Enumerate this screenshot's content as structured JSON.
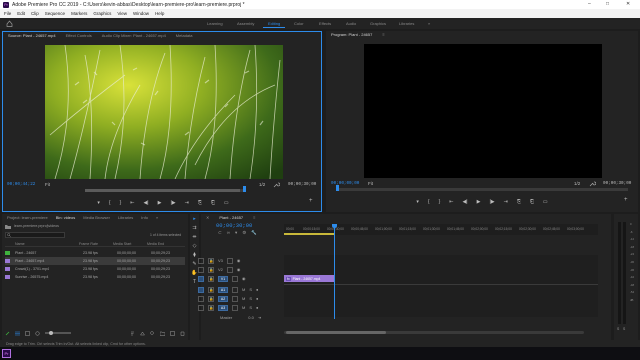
{
  "app": {
    "logo_text": "Pr",
    "title": "Adobe Premiere Pro CC 2019 - C:\\Users\\kevin-abbas\\Desktop\\learn-premiere-pro\\learn-premiere.prproj *",
    "window_controls": [
      "–",
      "□",
      "✕"
    ]
  },
  "menu": [
    "File",
    "Edit",
    "Clip",
    "Sequence",
    "Markers",
    "Graphics",
    "View",
    "Window",
    "Help"
  ],
  "workspaces": {
    "home_icon": "home-icon",
    "items": [
      "Learning",
      "Assembly",
      "Editing",
      "Color",
      "Effects",
      "Audio",
      "Graphics",
      "Libraries"
    ],
    "active": "Editing",
    "more": "»"
  },
  "source": {
    "tabs": [
      "Source: Plant - 24657.mp4",
      "Effect Controls",
      "Audio Clip Mixer: Plant - 24657.mp4",
      "Metadata"
    ],
    "timecode_in": "00;00;44;22",
    "fit": "Fit",
    "resolution": "1/2",
    "timecode_out": "00;00;30;00",
    "buttons": [
      "▾",
      "{",
      "}",
      "⇤",
      "◀|",
      "▶",
      "|▶",
      "⇥",
      "⎘",
      "⎗",
      "▭",
      "+"
    ]
  },
  "program": {
    "tabs": [
      "Program: Plant - 24657",
      "≡"
    ],
    "timecode_in": "00;00;00;00",
    "fit": "Fit",
    "resolution": "1/2",
    "timecode_out": "00;00;30;00",
    "buttons": [
      "▾",
      "{",
      "}",
      "⇤",
      "◀|",
      "▶",
      "|▶",
      "⇥",
      "⎘",
      "⎗",
      "▭",
      "+"
    ]
  },
  "project": {
    "tabs": [
      "Project: learn-premiere",
      "Bin: videos",
      "Media Browser",
      "Libraries",
      "Info",
      "»"
    ],
    "path": "learn-premiere.prproj\\videos",
    "selected_count": "1 of 4 items selected",
    "columns": [
      "Name",
      "Frame Rate",
      "Media Start",
      "Media End"
    ],
    "rows": [
      {
        "name": "Plant - 24657",
        "fps": "23.98 fps",
        "start": "00;00;00;00",
        "end": "00;00;29;23",
        "color": "#3fb23f"
      },
      {
        "name": "Plant - 24657.mp4",
        "fps": "23.98 fps",
        "start": "00;00;00;00",
        "end": "00;00;29;23",
        "color": "#9a78d6"
      },
      {
        "name": "Crowd(1) - 3701.mp4",
        "fps": "23.98 fps",
        "start": "00;00;00;00",
        "end": "00;00;29;23",
        "color": "#9a78d6"
      },
      {
        "name": "Sunrise - 26575.mp4",
        "fps": "23.98 fps",
        "start": "00;00;00;00",
        "end": "00;00;29;23",
        "color": "#9a78d6"
      }
    ],
    "bottom_icons": [
      "pencil-icon",
      "list-view-icon",
      "icon-view-icon",
      "freeform-view-icon",
      "zoom-slider",
      "sort-icon",
      "automate-icon",
      "find-icon",
      "new-bin-icon",
      "new-item-icon",
      "clear-icon"
    ]
  },
  "tools": [
    "▸",
    "⇉",
    "⇹",
    "◇",
    "⧫",
    "✎",
    "✋",
    "T"
  ],
  "timeline": {
    "tab": "Plant - 24657",
    "menu": "≡",
    "timecode": "00;00;30;00",
    "ruler": [
      "00;00",
      "00;00;15;00",
      "00;00;30;00",
      "00;00;45;00",
      "00;01;00;00",
      "00;01;15;00",
      "00;01;30;00",
      "00;01;45;00",
      "00;02;00;00",
      "00;02;15;00",
      "00;02;30;00",
      "00;02;45;00",
      "00;03;00;00"
    ],
    "video_tracks": [
      "V3",
      "V2",
      "V1"
    ],
    "audio_tracks": [
      "A1",
      "A2",
      "A3"
    ],
    "master_label": "Master",
    "master_value": "0.0",
    "clip_label": "Plant - 24657.mp4",
    "clip_fx": "fx"
  },
  "meters": {
    "labels": [
      "0",
      "-6",
      "-12",
      "-18",
      "-24",
      "-30",
      "-36",
      "-42",
      "-48",
      "-54",
      "dB"
    ],
    "solo": [
      "S",
      "S"
    ]
  },
  "status": {
    "text": "Drag edge to Trim. Ctrl selects Trim In/Out. Alt selects linked clip, Cmd for other options."
  },
  "taskbar": {
    "app_icon": "premiere-taskbar-icon",
    "colors": {
      "accent": "#2d8ceb",
      "premiere": "#2a0b4a",
      "clip": "#9a78d6"
    }
  }
}
